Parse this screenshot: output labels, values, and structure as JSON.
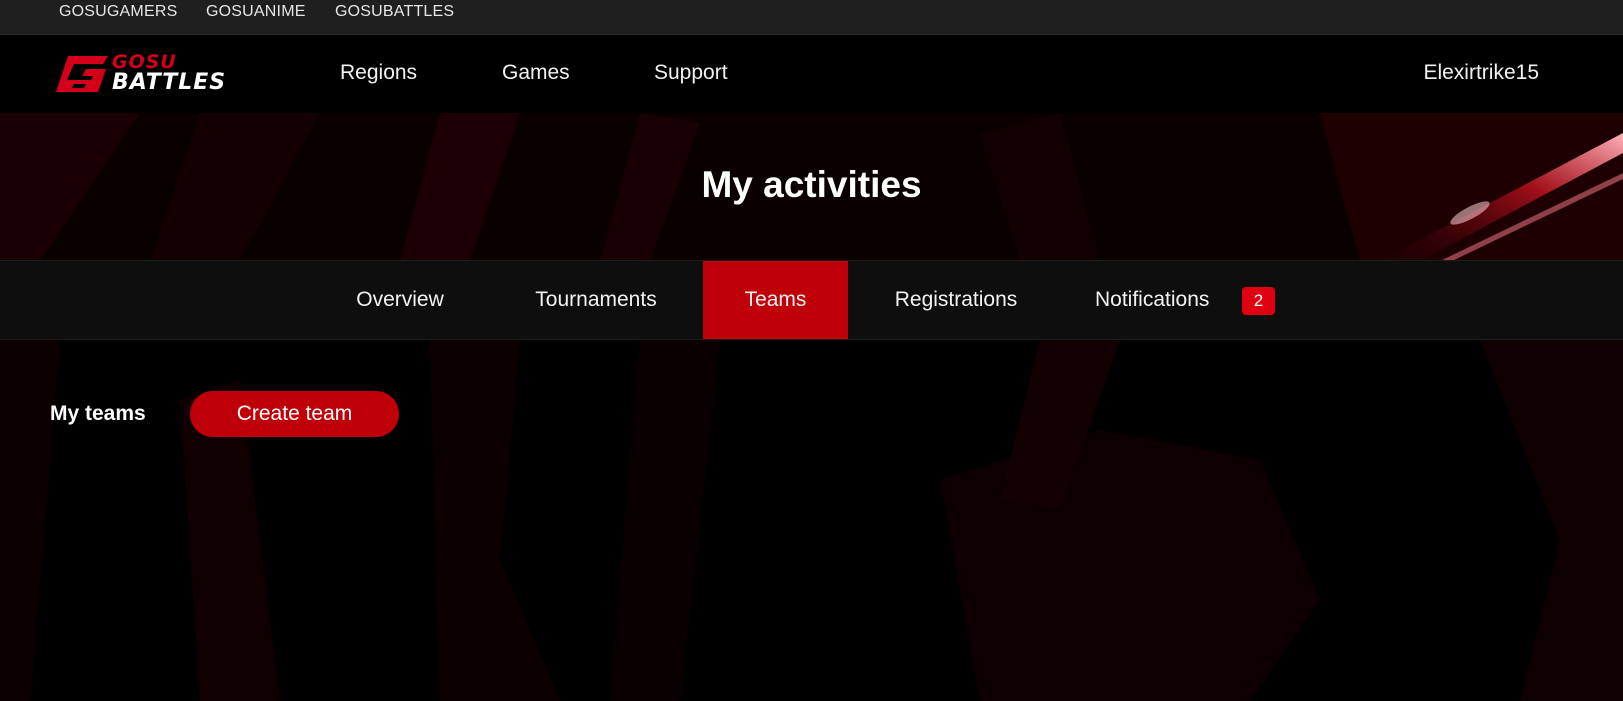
{
  "network_links": [
    "GOSUGAMERS",
    "GOSUANIME",
    "GOSUBATTLES"
  ],
  "logo": {
    "top": "GOSU",
    "bottom": "BATTLES"
  },
  "main_nav": {
    "regions": "Regions",
    "games": "Games",
    "support": "Support"
  },
  "user": {
    "name": "Elexirtrike15"
  },
  "page": {
    "title": "My activities"
  },
  "tabs": [
    {
      "label": "Overview",
      "active": false
    },
    {
      "label": "Tournaments",
      "active": false
    },
    {
      "label": "Teams",
      "active": true
    },
    {
      "label": "Registrations",
      "active": false
    },
    {
      "label": "Notifications",
      "active": false,
      "badge": "2"
    }
  ],
  "teams_section": {
    "label": "My teams",
    "create_button": "Create team"
  },
  "colors": {
    "accent": "#c00008",
    "badge": "#e00010",
    "logo_red": "#d4001a",
    "background": "#000000"
  }
}
